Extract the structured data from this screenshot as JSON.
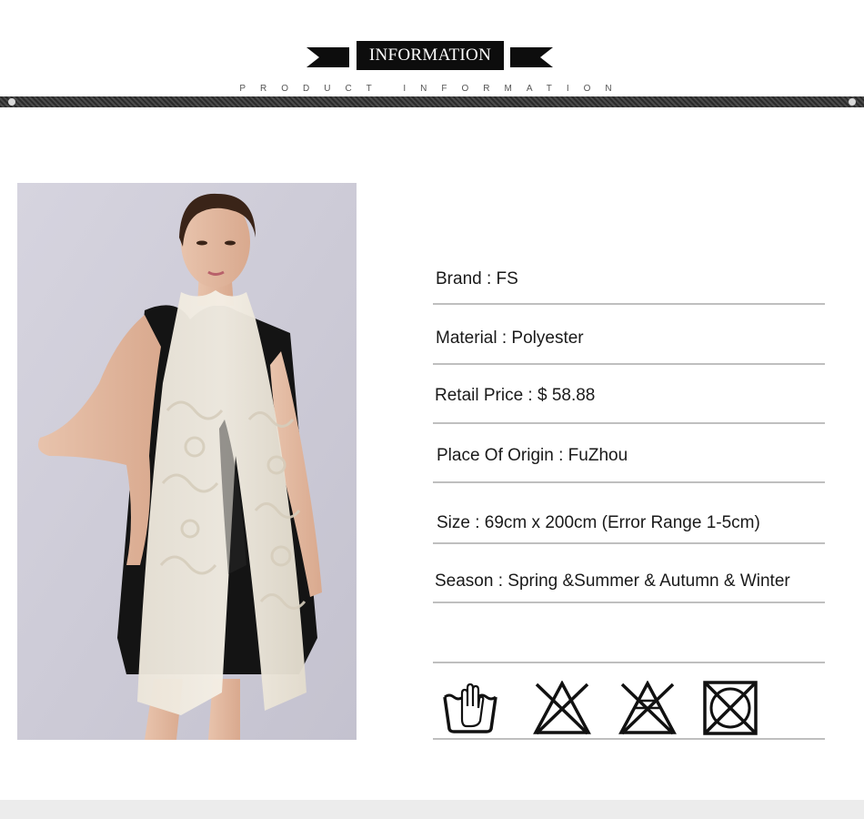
{
  "header": {
    "title": "INFORMATION",
    "subtitle": "PRODUCT INFORMATION"
  },
  "product": {
    "brand": "Brand : FS",
    "material": "Material :  Polyester",
    "retail_price": "Retail Price : $ 58.88",
    "origin": "Place Of Origin : FuZhou",
    "size": "Size : 69cm x 200cm (Error Range 1-5cm)",
    "season": "Season : Spring &Summer & Autumn & Winter"
  },
  "care_icons": [
    "hand-wash-icon",
    "do-not-bleach-icon",
    "do-not-bleach-crossed-icon",
    "do-not-tumble-dry-icon"
  ],
  "colors": {
    "banner": "#0d0d0d",
    "rule": "#bfbfbf",
    "photo_bg": "#cfcdd8"
  }
}
